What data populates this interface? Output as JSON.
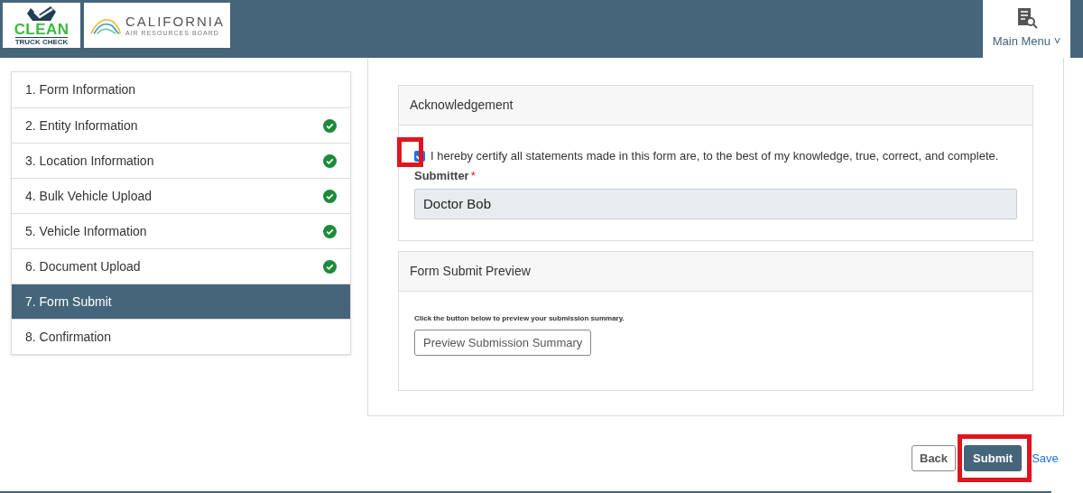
{
  "header": {
    "logo_primary": [
      "CLEAN",
      "TRUCK CHECK"
    ],
    "logo_secondary": [
      "CALIFORNIA",
      "AIR RESOURCES BOARD"
    ],
    "menu": {
      "label": "Main Menu",
      "caret": "˅"
    }
  },
  "steps": [
    {
      "label": "1. Form Information",
      "completed": false,
      "selected": false
    },
    {
      "label": "2. Entity Information",
      "completed": true,
      "selected": false
    },
    {
      "label": "3. Location Information",
      "completed": true,
      "selected": false
    },
    {
      "label": "4. Bulk Vehicle Upload",
      "completed": true,
      "selected": false
    },
    {
      "label": "5. Vehicle Information",
      "completed": true,
      "selected": false
    },
    {
      "label": "6. Document Upload",
      "completed": true,
      "selected": false
    },
    {
      "label": "7. Form Submit",
      "completed": false,
      "selected": true
    },
    {
      "label": "8. Confirmation",
      "completed": false,
      "selected": false
    }
  ],
  "acknowledgement": {
    "title": "Acknowledgement",
    "certify": {
      "label": "I hereby certify all statements made in this form are, to the best of my knowledge, true, correct, and complete.",
      "checked": true,
      "highlighted": true
    },
    "submitter": {
      "label": "Submitter",
      "required_mark": "*",
      "value": "Doctor Bob"
    }
  },
  "preview": {
    "title": "Form Submit Preview",
    "hint": "Click the button below to preview your submission summary.",
    "button": "Preview Submission Summary"
  },
  "actions": {
    "back": "Back",
    "submit": "Submit",
    "submit_highlighted": true,
    "save": "Save"
  }
}
